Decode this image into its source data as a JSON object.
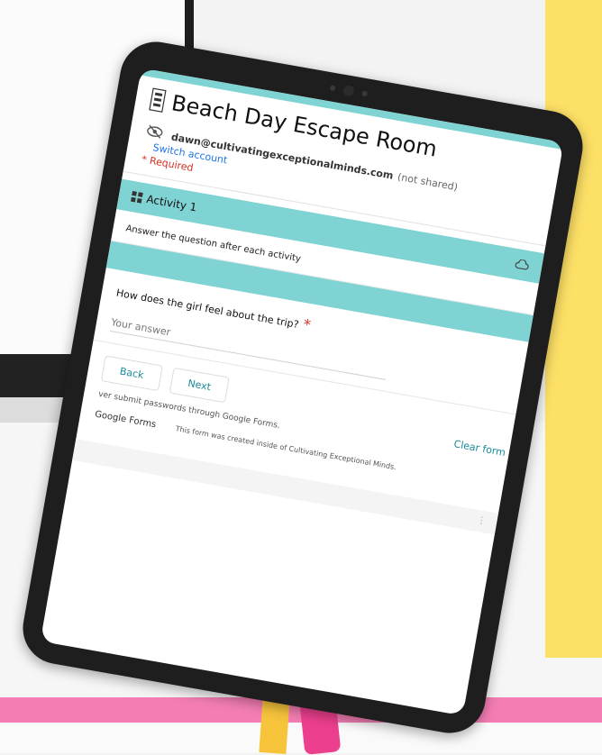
{
  "form": {
    "title": "Beach Day Escape Room",
    "account_email": "dawn@cultivatingexceptionalminds.com",
    "account_note": "(not shared)",
    "switch_account": "Switch account",
    "required_note": "* Required",
    "section_title": "Activity 1",
    "instructions": "Answer the question after each activity",
    "question": "How does the girl feel about the trip?",
    "required_mark": "*",
    "answer_placeholder": "Your answer",
    "back_label": "Back",
    "next_label": "Next",
    "password_warning": "ver submit passwords through Google Forms.",
    "clear_form": "Clear form",
    "brand": "Google Forms",
    "footer_note": "This form was created inside of Cultivating Exceptional Minds."
  },
  "colors": {
    "accent": "#7fd3d3",
    "link": "#1a73e8",
    "required": "#d93025",
    "background_yellow": "#fde066",
    "background_pink": "#f47eb4"
  },
  "icons": [
    "form-logo-icon",
    "eye-off-icon",
    "grid-icon",
    "cloud-icon"
  ]
}
